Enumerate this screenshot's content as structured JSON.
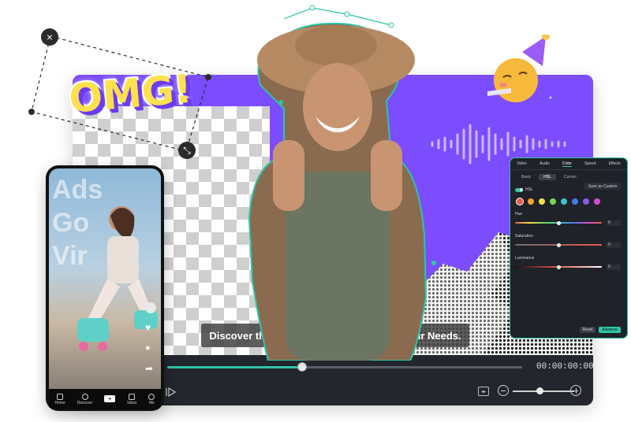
{
  "editor": {
    "caption": "Discover the Perfect Video Solution for Your Needs.",
    "timecode": "00:00:00:00",
    "progress": 0.38,
    "zoom_level": 0.38
  },
  "sticker": {
    "text": "OMG!"
  },
  "phone": {
    "overlay_lines": [
      "Ads",
      "Go",
      "Vir"
    ],
    "nav": [
      {
        "label": "Home",
        "icon": "home-icon"
      },
      {
        "label": "Discover",
        "icon": "search-icon"
      },
      {
        "label": "",
        "icon": "create-icon"
      },
      {
        "label": "Inbox",
        "icon": "inbox-icon"
      },
      {
        "label": "Me",
        "icon": "profile-icon"
      }
    ]
  },
  "panel": {
    "tabs": [
      "Video",
      "Audio",
      "Color",
      "Speed",
      "Effects"
    ],
    "subtabs": [
      "Basic",
      "HSL",
      "Curves"
    ],
    "save_label": "Save as Custom",
    "hsl_label": "HSL",
    "swatch_colors": [
      "#e85a4f",
      "#f0a23b",
      "#f3e04a",
      "#7cd35a",
      "#3fc4c9",
      "#3f7de8",
      "#8a5ae8",
      "#d24fd0"
    ],
    "sliders": [
      {
        "label": "Hue",
        "value": "0"
      },
      {
        "label": "Saturation",
        "value": "0"
      },
      {
        "label": "Luminance",
        "value": "0"
      }
    ],
    "reset_label": "Reset",
    "advance_label": "Advance"
  },
  "colors": {
    "accent": "#2ec4a6",
    "canvas_purple": "#7c4dff",
    "sticker_yellow": "#ffe14d"
  }
}
